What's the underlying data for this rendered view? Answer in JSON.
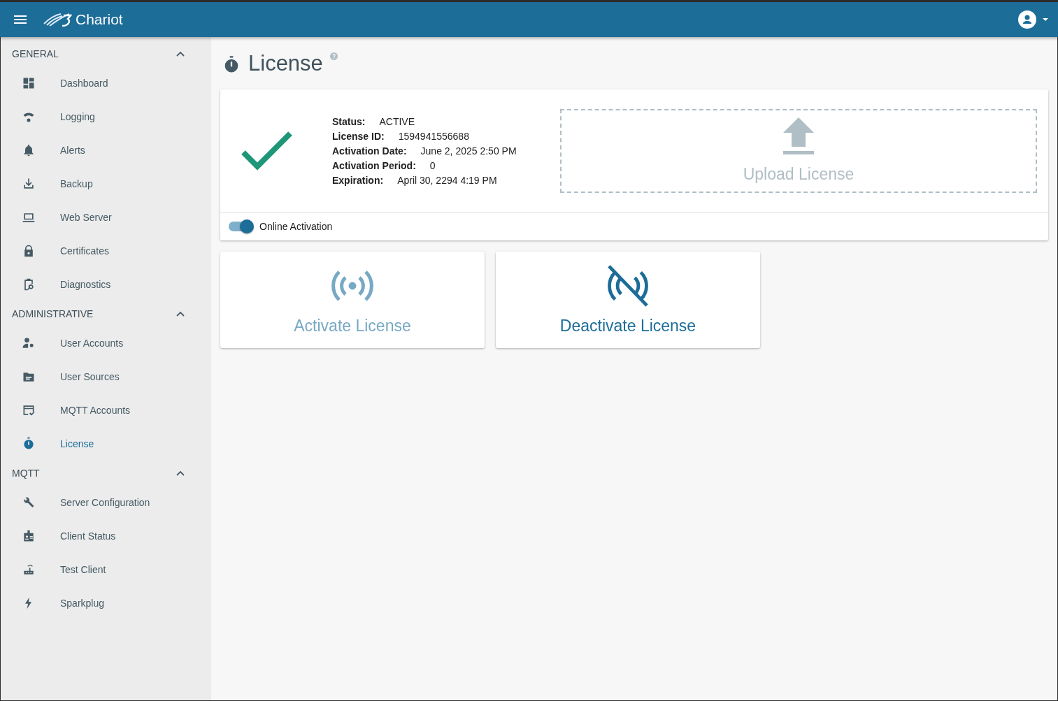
{
  "app_bar": {
    "title": "Chariot"
  },
  "sidebar": {
    "sections": [
      {
        "title": "GENERAL",
        "expanded": true,
        "items": [
          {
            "label": "Dashboard",
            "selected": false
          },
          {
            "label": "Logging",
            "selected": false
          },
          {
            "label": "Alerts",
            "selected": false
          },
          {
            "label": "Backup",
            "selected": false
          },
          {
            "label": "Web Server",
            "selected": false
          },
          {
            "label": "Certificates",
            "selected": false
          },
          {
            "label": "Diagnostics",
            "selected": false
          }
        ]
      },
      {
        "title": "ADMINISTRATIVE",
        "expanded": true,
        "items": [
          {
            "label": "User Accounts",
            "selected": false
          },
          {
            "label": "User Sources",
            "selected": false
          },
          {
            "label": "MQTT Accounts",
            "selected": false
          },
          {
            "label": "License",
            "selected": true
          }
        ]
      },
      {
        "title": "MQTT",
        "expanded": true,
        "items": [
          {
            "label": "Server Configuration",
            "selected": false
          },
          {
            "label": "Client Status",
            "selected": false
          },
          {
            "label": "Test Client",
            "selected": false
          },
          {
            "label": "Sparkplug",
            "selected": false
          }
        ]
      }
    ]
  },
  "page": {
    "title": "License"
  },
  "license": {
    "fields": [
      {
        "label": "Status:",
        "value": "ACTIVE"
      },
      {
        "label": "License ID:",
        "value": "1594941556688"
      },
      {
        "label": "Activation Date:",
        "value": "June 2, 2025 2:50 PM"
      },
      {
        "label": "Activation Period:",
        "value": "0"
      },
      {
        "label": "Expiration:",
        "value": "April 30, 2294 4:19 PM"
      }
    ],
    "upload": {
      "label": "Upload License",
      "disabled": true
    },
    "online_activation": {
      "label": "Online Activation",
      "on": true
    }
  },
  "actions": [
    {
      "label": "Activate License",
      "kind": "activate",
      "disabled": true
    },
    {
      "label": "Deactivate License",
      "kind": "deactivate",
      "disabled": false
    }
  ]
}
